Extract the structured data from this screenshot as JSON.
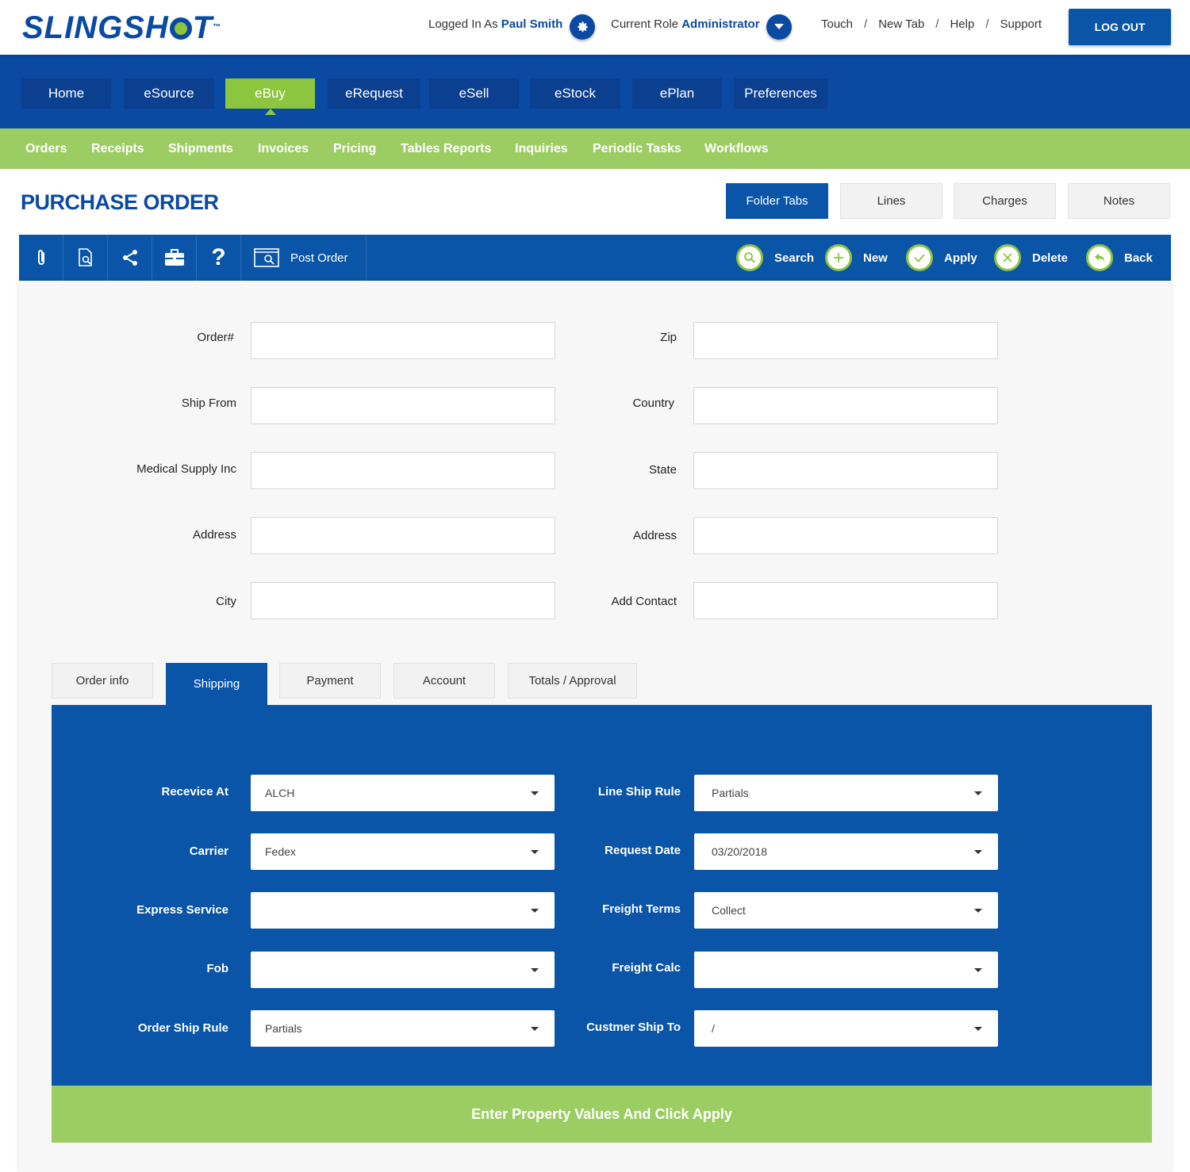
{
  "header": {
    "logo_text": "SLINGSHOT",
    "logged_in_prefix": "Logged In As",
    "user_name": "Paul Smith",
    "role_prefix": "Current Role",
    "role_name": "Administrator",
    "links": [
      "Touch",
      "New Tab",
      "Help",
      "Support"
    ],
    "logout_label": "LOG OUT"
  },
  "main_nav": [
    {
      "label": "Home",
      "active": false
    },
    {
      "label": "eSource",
      "active": false
    },
    {
      "label": "eBuy",
      "active": true
    },
    {
      "label": "eRequest",
      "active": false
    },
    {
      "label": "eSell",
      "active": false
    },
    {
      "label": "eStock",
      "active": false
    },
    {
      "label": "ePlan",
      "active": false
    },
    {
      "label": "Preferences",
      "active": false
    }
  ],
  "sub_nav": [
    "Orders",
    "Receipts",
    "Shipments",
    "Invoices",
    "Pricing",
    "Tables Reports",
    "Inquiries",
    "Periodic Tasks",
    "Workflows"
  ],
  "page": {
    "title": "PURCHASE ORDER",
    "right_tabs": [
      {
        "label": "Folder Tabs",
        "active": true
      },
      {
        "label": "Lines",
        "active": false
      },
      {
        "label": "Charges",
        "active": false
      },
      {
        "label": "Notes",
        "active": false
      }
    ]
  },
  "toolbar": {
    "icons": [
      "paperclip-icon",
      "document-search-icon",
      "share-icon",
      "briefcase-icon",
      "help-icon"
    ],
    "post_order_label": "Post Order",
    "actions": [
      "Search",
      "New",
      "Apply",
      "Delete",
      "Back"
    ]
  },
  "form": {
    "left": [
      {
        "label": "Order#",
        "value": ""
      },
      {
        "label": "Ship From",
        "value": ""
      },
      {
        "label": "Medical Supply Inc",
        "value": ""
      },
      {
        "label": "Address",
        "value": ""
      },
      {
        "label": "City",
        "value": ""
      }
    ],
    "right": [
      {
        "label": "Zip",
        "value": ""
      },
      {
        "label": "Country",
        "value": ""
      },
      {
        "label": "State",
        "value": ""
      },
      {
        "label": "Address",
        "value": ""
      },
      {
        "label": "Add Contact",
        "value": ""
      }
    ]
  },
  "tabs": [
    {
      "label": "Order info",
      "active": false
    },
    {
      "label": "Shipping",
      "active": true
    },
    {
      "label": "Payment",
      "active": false
    },
    {
      "label": "Account",
      "active": false
    },
    {
      "label": "Totals / Approval",
      "active": false
    }
  ],
  "shipping": {
    "left": [
      {
        "label": "Recevice At",
        "value": "ALCH"
      },
      {
        "label": "Carrier",
        "value": "Fedex"
      },
      {
        "label": "Express Service",
        "value": ""
      },
      {
        "label": "Fob",
        "value": ""
      },
      {
        "label": "Order Ship Rule",
        "value": "Partials"
      }
    ],
    "right": [
      {
        "label": "Line Ship Rule",
        "value": "Partials"
      },
      {
        "label": "Request Date",
        "value": "03/20/2018"
      },
      {
        "label": "Freight Terms",
        "value": "Collect"
      },
      {
        "label": "Freight Calc",
        "value": ""
      },
      {
        "label": "Custmer Ship To",
        "value": "/"
      }
    ]
  },
  "footer_message": "Enter Property Values And Click Apply",
  "colors": {
    "brand_blue": "#0a4aa3",
    "panel_blue": "#0a55a8",
    "accent_green": "#8cc63f"
  }
}
